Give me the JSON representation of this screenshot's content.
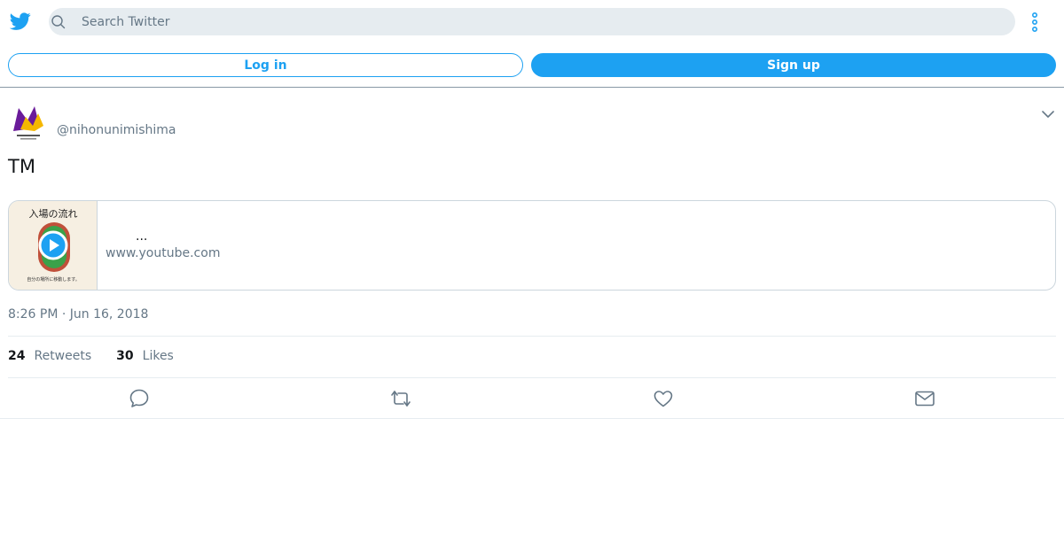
{
  "header": {
    "logo_icon": "twitter-bird-icon",
    "search_placeholder": "Search Twitter",
    "search_value": "",
    "more_icon": "more-vertical-icon"
  },
  "auth": {
    "login_label": "Log in",
    "signup_label": "Sign up"
  },
  "tweet": {
    "handle": "@nihonunimishima",
    "text": "TM",
    "timestamp": "8:26 PM · Jun 16, 2018",
    "card": {
      "thumbnail_title": "入場の流れ",
      "thumbnail_caption": "自分の場所に移動します。",
      "title": "...",
      "domain": "www.youtube.com"
    },
    "stats": {
      "retweets_count": "24",
      "retweets_label": "Retweets",
      "likes_count": "30",
      "likes_label": "Likes"
    }
  },
  "colors": {
    "accent": "#1da1f2",
    "secondary_text": "#657786",
    "search_bg": "#e6ecf0"
  }
}
